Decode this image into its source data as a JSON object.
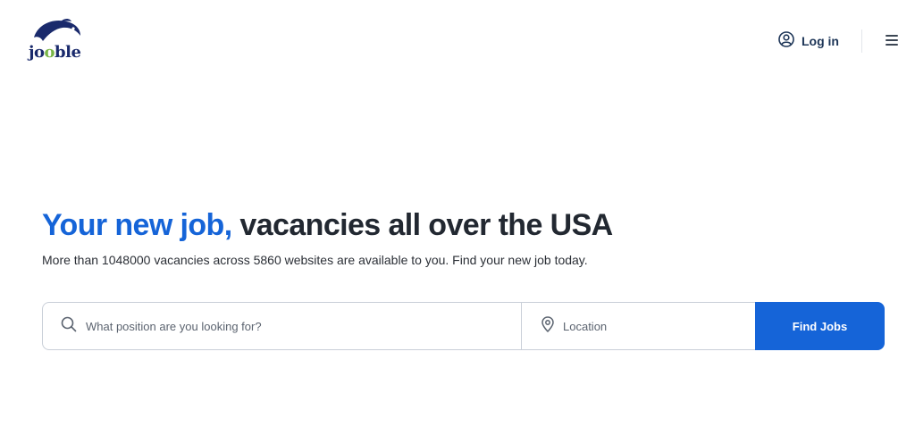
{
  "brand": {
    "name_part1": "jo",
    "name_part2": "o",
    "name_part3": "ble"
  },
  "header": {
    "login_label": "Log in"
  },
  "hero": {
    "title_accent": "Your new job,",
    "title_rest": " vacancies all over the USA",
    "subtitle": "More than 1048000 vacancies across 5860 websites are available to you. Find your new job today."
  },
  "search": {
    "what_placeholder": "What position are you looking for?",
    "what_value": "",
    "where_placeholder": "Location",
    "where_value": "",
    "submit_label": "Find Jobs"
  },
  "colors": {
    "accent": "#1564d8",
    "text": "#222831",
    "logo_navy": "#1a2a6c",
    "logo_green": "#7ab648"
  },
  "icons": [
    "user-circle-icon",
    "menu-icon",
    "search-icon",
    "location-pin-icon",
    "jooble-dolphin-logo"
  ]
}
